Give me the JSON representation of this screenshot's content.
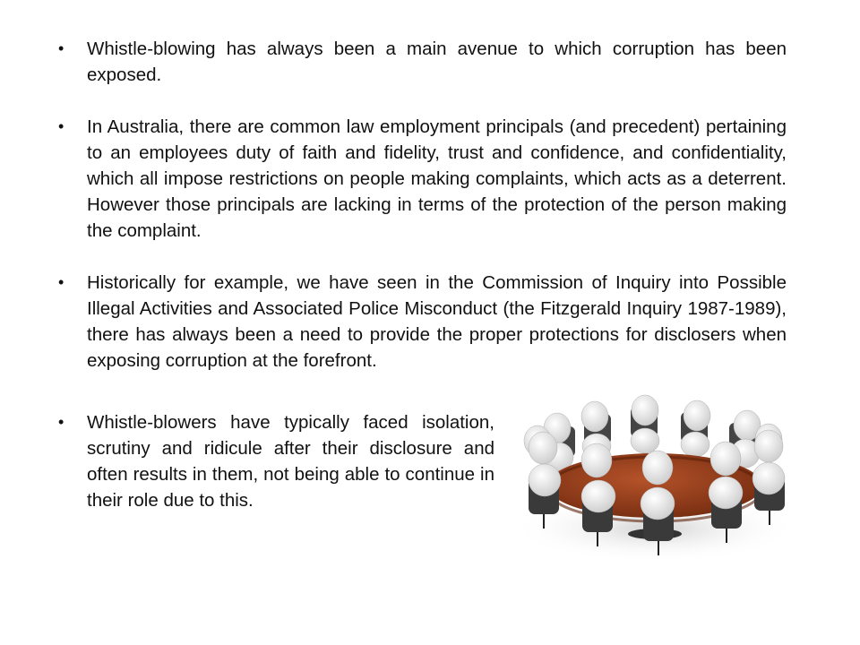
{
  "bullets": [
    {
      "marker": "•",
      "text": "Whistle-blowing has always been a main avenue to which corruption has been exposed."
    },
    {
      "marker": "•",
      "text": "In Australia, there are common law employment principals (and precedent) pertaining to an employees duty of faith and fidelity, trust and confidence, and confidentiality, which all impose restrictions on people making complaints, which acts as a deterrent. However those principals are lacking in terms of the protection of the person making the complaint."
    },
    {
      "marker": "•",
      "text": "Historically for example, we have seen in the Commission of Inquiry into Possible Illegal Activities and Associated Police Misconduct (the Fitzgerald Inquiry 1987-1989), there has always been a need to provide the proper protections for disclosers when exposing corruption at the forefront."
    },
    {
      "marker": "•",
      "text": "Whistle-blowers have typically faced isolation, scrutiny and ridicule after their disclosure and often results in them, not being able to continue in their role due to this."
    }
  ],
  "illustration": {
    "icon": "meeting-table-icon",
    "colors": {
      "table": "#8a3a1a",
      "figures": "#f2f2f2",
      "chairs": "#3a3a3a"
    }
  }
}
